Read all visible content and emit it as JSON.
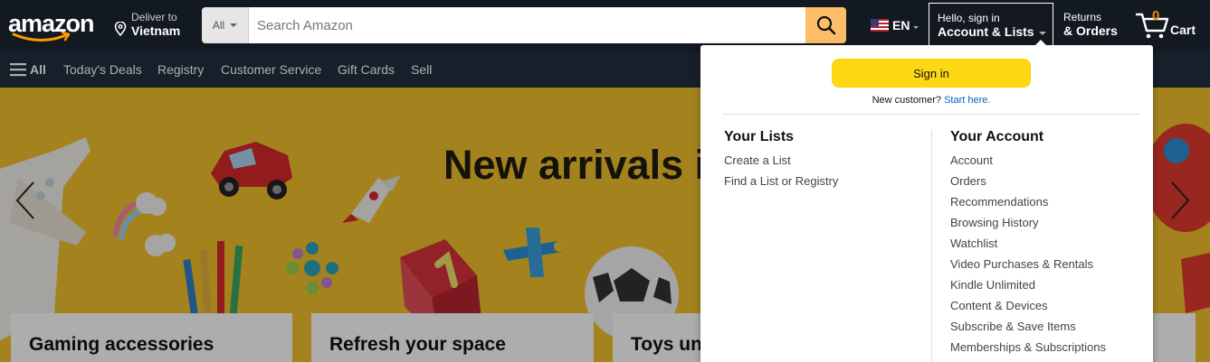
{
  "header": {
    "logo_text": "amazon",
    "deliver": {
      "line1": "Deliver to",
      "line2": "Vietnam"
    },
    "search": {
      "category": "All",
      "placeholder": "Search Amazon"
    },
    "language": {
      "code": "EN"
    },
    "account": {
      "line1": "Hello, sign in",
      "line2": "Account & Lists"
    },
    "returns": {
      "line1": "Returns",
      "line2": "& Orders"
    },
    "cart": {
      "count": "0",
      "label": "Cart"
    }
  },
  "subnav": {
    "all_label": "All",
    "items": [
      "Today's Deals",
      "Registry",
      "Customer Service",
      "Gift Cards",
      "Sell"
    ]
  },
  "hero": {
    "title": "New arrivals i",
    "cards": [
      "Gaming accessories",
      "Refresh your space",
      "Toys un"
    ]
  },
  "flyout": {
    "signin_button": "Sign in",
    "new_customer_text": "New customer?",
    "new_customer_link": "Start here.",
    "lists": {
      "heading": "Your Lists",
      "items": [
        "Create a List",
        "Find a List or Registry"
      ]
    },
    "account": {
      "heading": "Your Account",
      "items": [
        "Account",
        "Orders",
        "Recommendations",
        "Browsing History",
        "Watchlist",
        "Video Purchases & Rentals",
        "Kindle Unlimited",
        "Content & Devices",
        "Subscribe & Save Items",
        "Memberships & Subscriptions"
      ]
    }
  },
  "colors": {
    "nav_dark": "#131921",
    "nav_secondary": "#232f3e",
    "search_button": "#febd69",
    "signin_button": "#ffd814",
    "cart_count": "#f08804",
    "link": "#0066c0",
    "hero_bg": "#f2c12e"
  }
}
